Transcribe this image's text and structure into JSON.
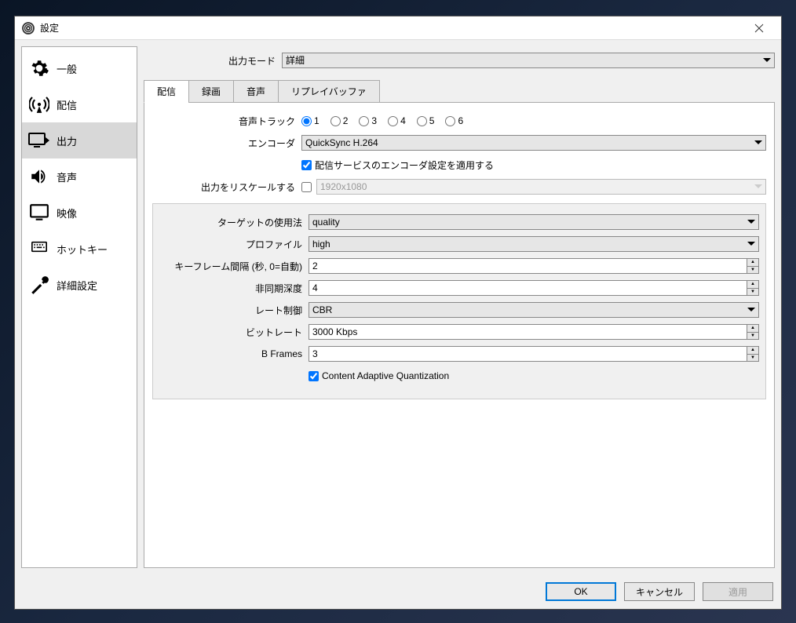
{
  "window": {
    "title": "設定"
  },
  "sidebar": {
    "items": [
      {
        "label": "一般"
      },
      {
        "label": "配信"
      },
      {
        "label": "出力"
      },
      {
        "label": "音声"
      },
      {
        "label": "映像"
      },
      {
        "label": "ホットキー"
      },
      {
        "label": "詳細設定"
      }
    ]
  },
  "top": {
    "outputModeLabel": "出力モード",
    "outputModeValue": "詳細"
  },
  "tabs": {
    "items": [
      {
        "label": "配信"
      },
      {
        "label": "録画"
      },
      {
        "label": "音声"
      },
      {
        "label": "リプレイバッファ"
      }
    ]
  },
  "stream": {
    "audioTrackLabel": "音声トラック",
    "audioTracks": [
      "1",
      "2",
      "3",
      "4",
      "5",
      "6"
    ],
    "encoderLabel": "エンコーダ",
    "encoderValue": "QuickSync H.264",
    "applyServiceLabel": "配信サービスのエンコーダ設定を適用する",
    "rescaleLabel": "出力をリスケールする",
    "rescaleValue": "1920x1080"
  },
  "encoder": {
    "targetUsageLabel": "ターゲットの使用法",
    "targetUsageValue": "quality",
    "profileLabel": "プロファイル",
    "profileValue": "high",
    "keyframeLabel": "キーフレーム間隔 (秒, 0=自動)",
    "keyframeValue": "2",
    "asyncDepthLabel": "非同期深度",
    "asyncDepthValue": "4",
    "rateControlLabel": "レート制御",
    "rateControlValue": "CBR",
    "bitrateLabel": "ビットレート",
    "bitrateValue": "3000 Kbps",
    "bFramesLabel": "B Frames",
    "bFramesValue": "3",
    "caqLabel": "Content Adaptive Quantization"
  },
  "footer": {
    "ok": "OK",
    "cancel": "キャンセル",
    "apply": "適用"
  }
}
